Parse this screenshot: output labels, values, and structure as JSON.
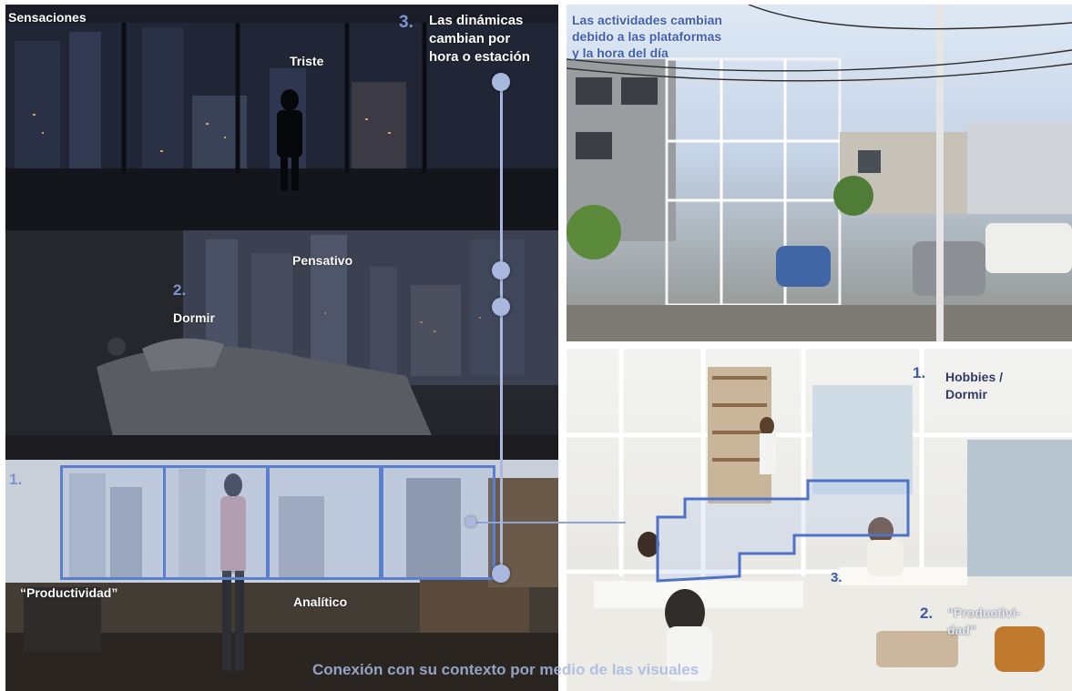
{
  "left": {
    "title": "Sensaciones",
    "moods": {
      "sad": "Triste",
      "thoughtful": "Pensativo",
      "analytic": "Analítico"
    },
    "timeline": {
      "number": "3.",
      "text": [
        "Las dinámicas",
        "cambian por",
        "hora o estación"
      ]
    },
    "sleep": {
      "number": "2.",
      "label": "Dormir"
    },
    "productivity": {
      "number": "1.",
      "label": "“Productividad”"
    }
  },
  "right": {
    "top_caption": [
      "Las actividades cambian",
      "debido a las plataformas",
      "y la hora del día"
    ],
    "hobbies": {
      "number": "1.",
      "label": [
        "Hobbies /",
        "Dormir"
      ]
    },
    "productivity": {
      "number": "2.",
      "label": [
        "“Productivi-",
        "dad”"
      ]
    },
    "step3": "3."
  },
  "footer": "Conexión con su contexto por medio de las visuales",
  "colors": {
    "accent": "#5b7fcf",
    "dot": "#aab8e0",
    "label_blue": "#7c94d4",
    "dark_blue": "#3a5aa8"
  }
}
